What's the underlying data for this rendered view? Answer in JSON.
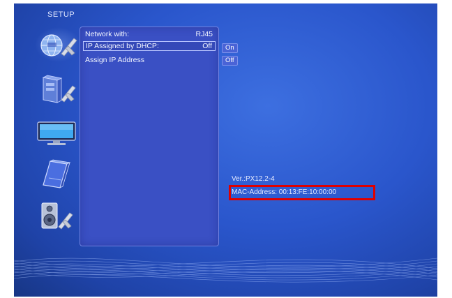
{
  "screen": {
    "title": "SETUP"
  },
  "sidebar": {
    "items": [
      {
        "name": "network-settings-icon",
        "selected": true
      },
      {
        "name": "system-settings-icon",
        "selected": false
      },
      {
        "name": "video-settings-icon",
        "selected": false
      },
      {
        "name": "preferences-settings-icon",
        "selected": false
      },
      {
        "name": "audio-settings-icon",
        "selected": false
      }
    ]
  },
  "menu": {
    "rows": [
      {
        "label": "Network with:",
        "value": "RJ45"
      },
      {
        "label": "IP Assigned by DHCP:",
        "value": "Off"
      },
      {
        "label": "Assign IP Address",
        "value": ""
      }
    ]
  },
  "options": {
    "on_label": "On",
    "off_label": "Off"
  },
  "info": {
    "version": "Ver.:PX12.2-4",
    "mac": "MAC-Address: 00:13:FE:10:00:00"
  },
  "colors": {
    "background": "#2a56cc",
    "panel": "#3a50c4",
    "highlight_box": "#e00000"
  }
}
